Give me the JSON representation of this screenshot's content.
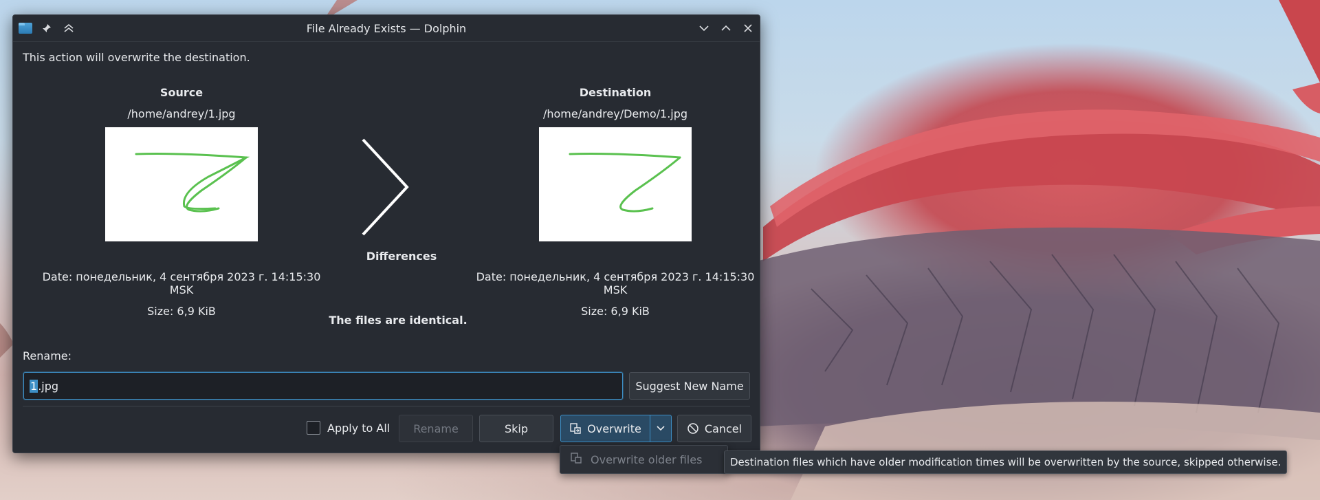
{
  "window": {
    "title": "File Already Exists — Dolphin",
    "message": "This action will overwrite the destination."
  },
  "source": {
    "heading": "Source",
    "path": "/home/andrey/1.jpg",
    "date": "Date: понедельник, 4 сентября 2023 г. 14:15:30 MSK",
    "size": "Size: 6,9 KiB"
  },
  "destination": {
    "heading": "Destination",
    "path": "/home/andrey/Demo/1.jpg",
    "date": "Date: понедельник, 4 сентября 2023 г. 14:15:30 MSK",
    "size": "Size: 6,9 KiB"
  },
  "differences": {
    "label": "Differences",
    "result": "The files are identical."
  },
  "rename": {
    "label": "Rename:",
    "value_selected": "1",
    "value_rest": ".jpg",
    "suggest_label": "Suggest New Name"
  },
  "actions": {
    "apply_to_all": "Apply to All",
    "rename": "Rename",
    "skip": "Skip",
    "overwrite": "Overwrite",
    "cancel": "Cancel"
  },
  "dropdown": {
    "item": "Overwrite older files"
  },
  "tooltip": {
    "text": "Destination files which have older modification times will be overwritten by the source, skipped otherwise."
  },
  "colors": {
    "accent": "#3d8fc6",
    "window_bg": "#272b32",
    "stroke_green": "#5ac14f"
  },
  "icons": {
    "app": "folder-icon",
    "pin": "pin-icon",
    "keep_above": "double-chevron-up-icon",
    "minimize": "chevron-down-icon",
    "maximize": "chevron-up-icon",
    "close": "close-icon",
    "overwrite": "copy-overwrite-icon",
    "cancel": "cancel-icon"
  }
}
